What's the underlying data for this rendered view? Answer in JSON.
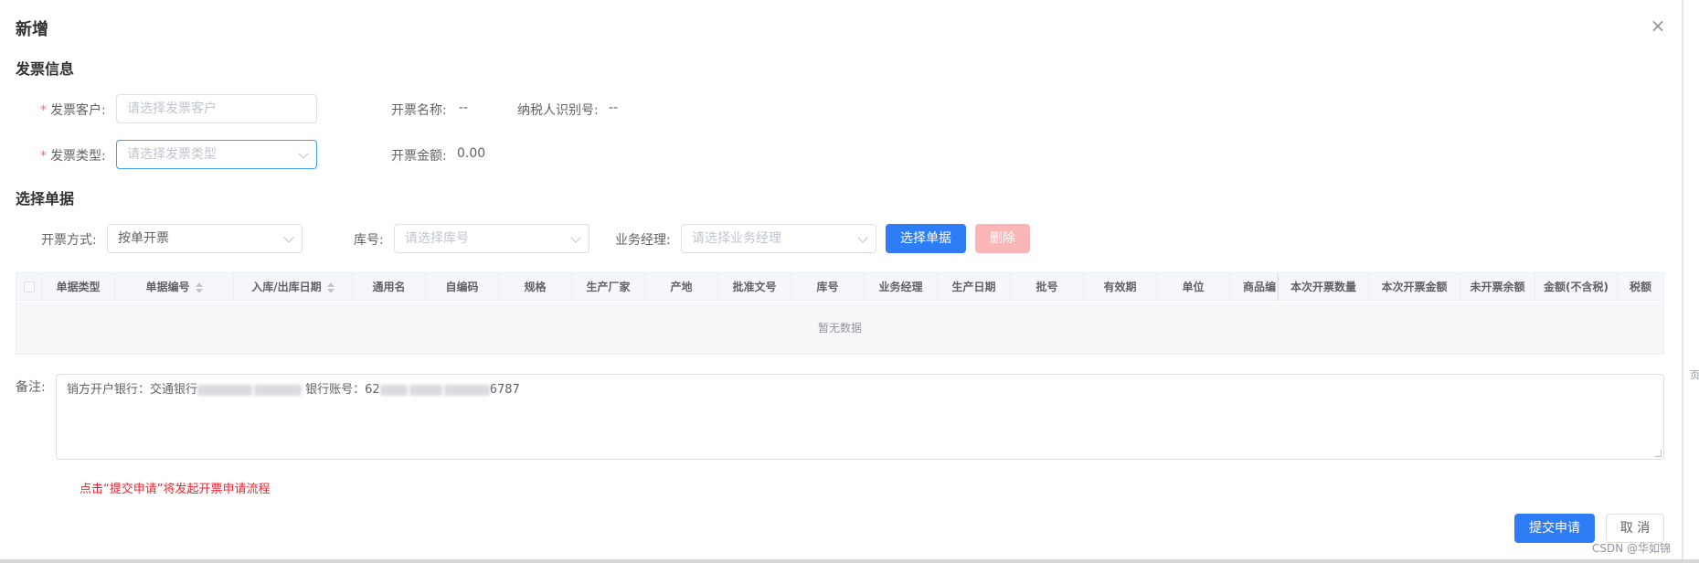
{
  "dialog": {
    "title": "新增"
  },
  "invoice_info": {
    "section_title": "发票信息",
    "customer": {
      "label": "发票客户:",
      "placeholder": "请选择发票客户"
    },
    "type": {
      "label": "发票类型:",
      "placeholder": "请选择发票类型"
    },
    "invoice_name": {
      "label": "开票名称:",
      "value": "--"
    },
    "tax_id": {
      "label": "纳税人识别号:",
      "value": "--"
    },
    "amount": {
      "label": "开票金额:",
      "value": "0.00"
    }
  },
  "select_docs": {
    "section_title": "选择单据",
    "method": {
      "label": "开票方式:",
      "value": "按单开票"
    },
    "warehouse": {
      "label": "库号:",
      "placeholder": "请选择库号"
    },
    "manager": {
      "label": "业务经理:",
      "placeholder": "请选择业务经理"
    },
    "select_btn": "选择单据",
    "delete_btn": "删除"
  },
  "table": {
    "columns": [
      "单据类型",
      "单据编号",
      "入库/出库日期",
      "通用名",
      "自编码",
      "规格",
      "生产厂家",
      "产地",
      "批准文号",
      "库号",
      "业务经理",
      "生产日期",
      "批号",
      "有效期",
      "单位",
      "商品编",
      "本次开票数量",
      "本次开票金额",
      "未开票余额",
      "金额(不含税)",
      "税额"
    ],
    "empty_text": "暂无数据"
  },
  "remark": {
    "label": "备注:",
    "text_prefix": "销方开户银行：交通银行",
    "text_middle": "银行账号：62",
    "text_suffix": "6787"
  },
  "hint": "点击“提交申请”将发起开票申请流程",
  "footer": {
    "submit": "提交申请",
    "cancel": "取 消"
  },
  "watermark": "CSDN @华如锦",
  "edge_text": "页"
}
